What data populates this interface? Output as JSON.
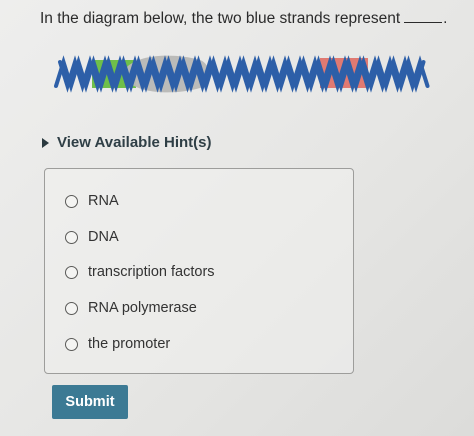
{
  "question": {
    "text": "In the diagram below, the two blue strands represent",
    "period": "."
  },
  "hint": {
    "label": "View Available Hint(s)"
  },
  "options": [
    {
      "label": "RNA"
    },
    {
      "label": "DNA"
    },
    {
      "label": "transcription factors"
    },
    {
      "label": "RNA polymerase"
    },
    {
      "label": "the promoter"
    }
  ],
  "submit": {
    "label": "Submit"
  },
  "colors": {
    "strand": "#2d5fa8",
    "green_region": "#6fbf4a",
    "gray_blob": "#b8b8b6",
    "red_region": "#e07a72",
    "submit_bg": "#3c7a94"
  }
}
